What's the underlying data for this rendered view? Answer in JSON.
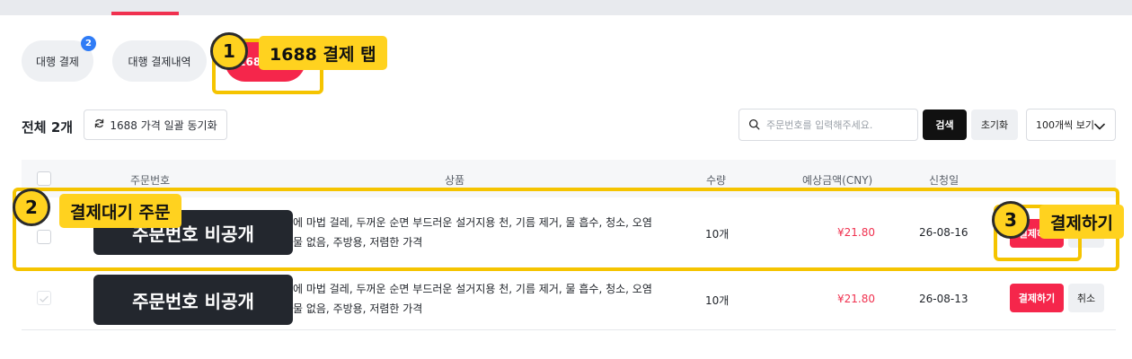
{
  "tabs": [
    {
      "label": "대행 결제",
      "badge": "2"
    },
    {
      "label": "대행 결제내역"
    },
    {
      "label": "1688 결제"
    }
  ],
  "callouts": [
    {
      "number": "1",
      "label": "1688 결제 탭"
    },
    {
      "number": "2",
      "label": "결제대기 주문"
    },
    {
      "number": "3",
      "label": "결제하기"
    }
  ],
  "toolbar": {
    "total": "전체 2개",
    "sync_label": "1688 가격 일괄 동기화",
    "search_placeholder": "주문번호를 입력해주세요.",
    "search_button": "검색",
    "reset_button": "초기화",
    "page_size": "100개씩 보기"
  },
  "table": {
    "headers": {
      "order_no": "주문번호",
      "product": "상품",
      "quantity": "수량",
      "amount": "예상금액(CNY)",
      "date": "신청일"
    },
    "rows": [
      {
        "order_no": "주문번호 비공개",
        "product_line1": "에 마법 걸레, 두꺼운 순면 부드러운 설거지용 천, 기름 제거, 물 흡수, 청소, 오염",
        "product_line2": "물 없음, 주방용, 저렴한 가격",
        "quantity": "10개",
        "amount": "¥21.80",
        "date": "26-08-16",
        "pay_label": "결제하기",
        "cancel_label": "취소"
      },
      {
        "order_no": "주문번호 비공개",
        "product_line1": "에 마법 걸레, 두꺼운 순면 부드러운 설거지용 천, 기름 제거, 물 흡수, 청소, 오염",
        "product_line2": "물 없음, 주방용, 저렴한 가격",
        "quantity": "10개",
        "amount": "¥21.80",
        "date": "26-08-13",
        "pay_label": "결제하기",
        "cancel_label": "취소"
      }
    ]
  },
  "colors": {
    "accent": "#f5264b",
    "highlight": "#ffd21f",
    "badge": "#2f7cf6"
  }
}
